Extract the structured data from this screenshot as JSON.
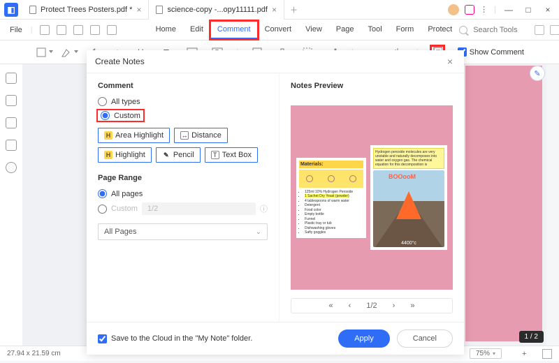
{
  "titlebar": {
    "tabs": [
      {
        "label": "Protect Trees Posters.pdf *"
      },
      {
        "label": "science-copy -...opy11111.pdf"
      }
    ],
    "window_buttons": {
      "minimize": "—",
      "maximize": "□",
      "close": "×"
    }
  },
  "menubar": {
    "file": "File",
    "tabs": [
      "Home",
      "Edit",
      "Comment",
      "Convert",
      "View",
      "Page",
      "Tool",
      "Form",
      "Protect"
    ],
    "active_tab": "Comment",
    "search_placeholder": "Search Tools"
  },
  "toolbar": {
    "show_comment_label": "Show Comment",
    "show_comment_checked": true
  },
  "modal": {
    "title": "Create Notes",
    "comment_section": "Comment",
    "radio_all_types": "All types",
    "radio_custom": "Custom",
    "selected_radio": "Custom",
    "chips": [
      "Area Highlight",
      "Distance",
      "Highlight",
      "Pencil",
      "Text Box"
    ],
    "page_range_section": "Page Range",
    "radio_all_pages": "All pages",
    "radio_page_custom": "Custom",
    "page_selected": "All pages",
    "page_custom_value": "1/2",
    "select_value": "All Pages",
    "preview_label": "Notes Preview",
    "preview_note1_header": "Materials:",
    "preview_note1_items": [
      "125ml 10% Hydrogen Peroxide",
      "1 Sachet Dry Yeast (powder)",
      "4 tablespoons of warm water",
      "Detergent",
      "Food color",
      "Empty bottle",
      "Funnel",
      "Plastic tray or tub",
      "Dishwashing gloves",
      "Safty goggles"
    ],
    "preview_note2_sticky": "Hydrogen peroxide molecules are very unstable and naturally decomposes into water and oxygen gas. The chemical equation for this decomposition is",
    "preview_note2_cloud": "BOOooM",
    "preview_note2_temp": "4400°c",
    "pager": {
      "first": "«",
      "prev": "‹",
      "value": "1/2",
      "next": "›",
      "last": "»"
    },
    "save_cloud_label": "Save to the Cloud in the \"My Note\" folder.",
    "save_cloud_checked": true,
    "apply_label": "Apply",
    "cancel_label": "Cancel"
  },
  "statusbar": {
    "dimensions": "27.94 x 21.59 cm",
    "zoom": "75%"
  },
  "page_indicator": "1 / 2"
}
